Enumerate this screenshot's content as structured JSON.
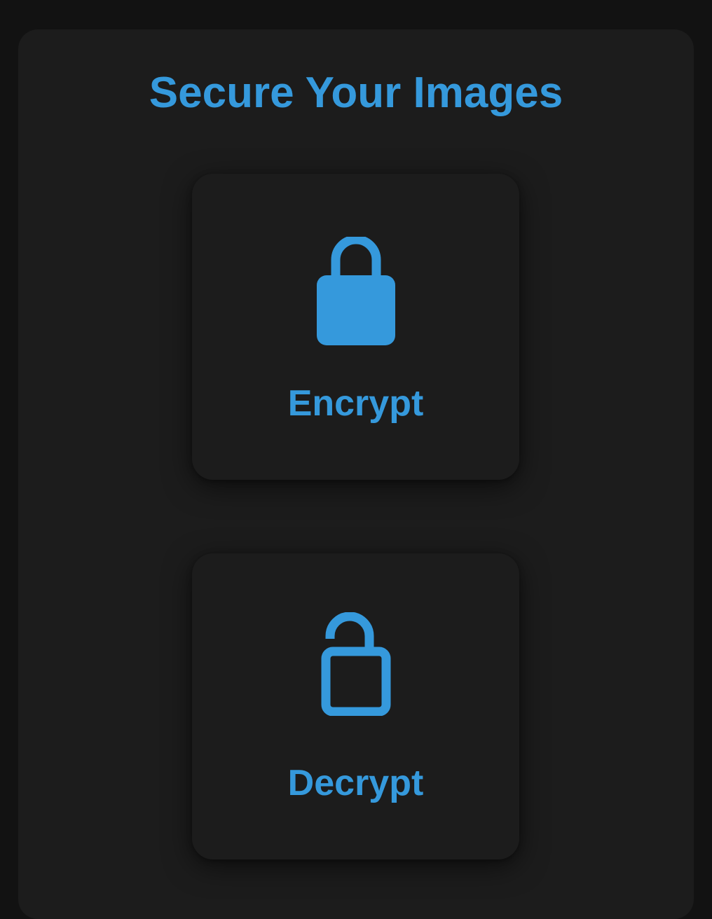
{
  "page": {
    "title": "Secure Your Images"
  },
  "actions": [
    {
      "label": "Encrypt",
      "icon": "lock-closed-icon"
    },
    {
      "label": "Decrypt",
      "icon": "lock-open-icon"
    }
  ],
  "colors": {
    "background": "#121212",
    "panel": "#1c1c1c",
    "accent": "#3599dc"
  }
}
